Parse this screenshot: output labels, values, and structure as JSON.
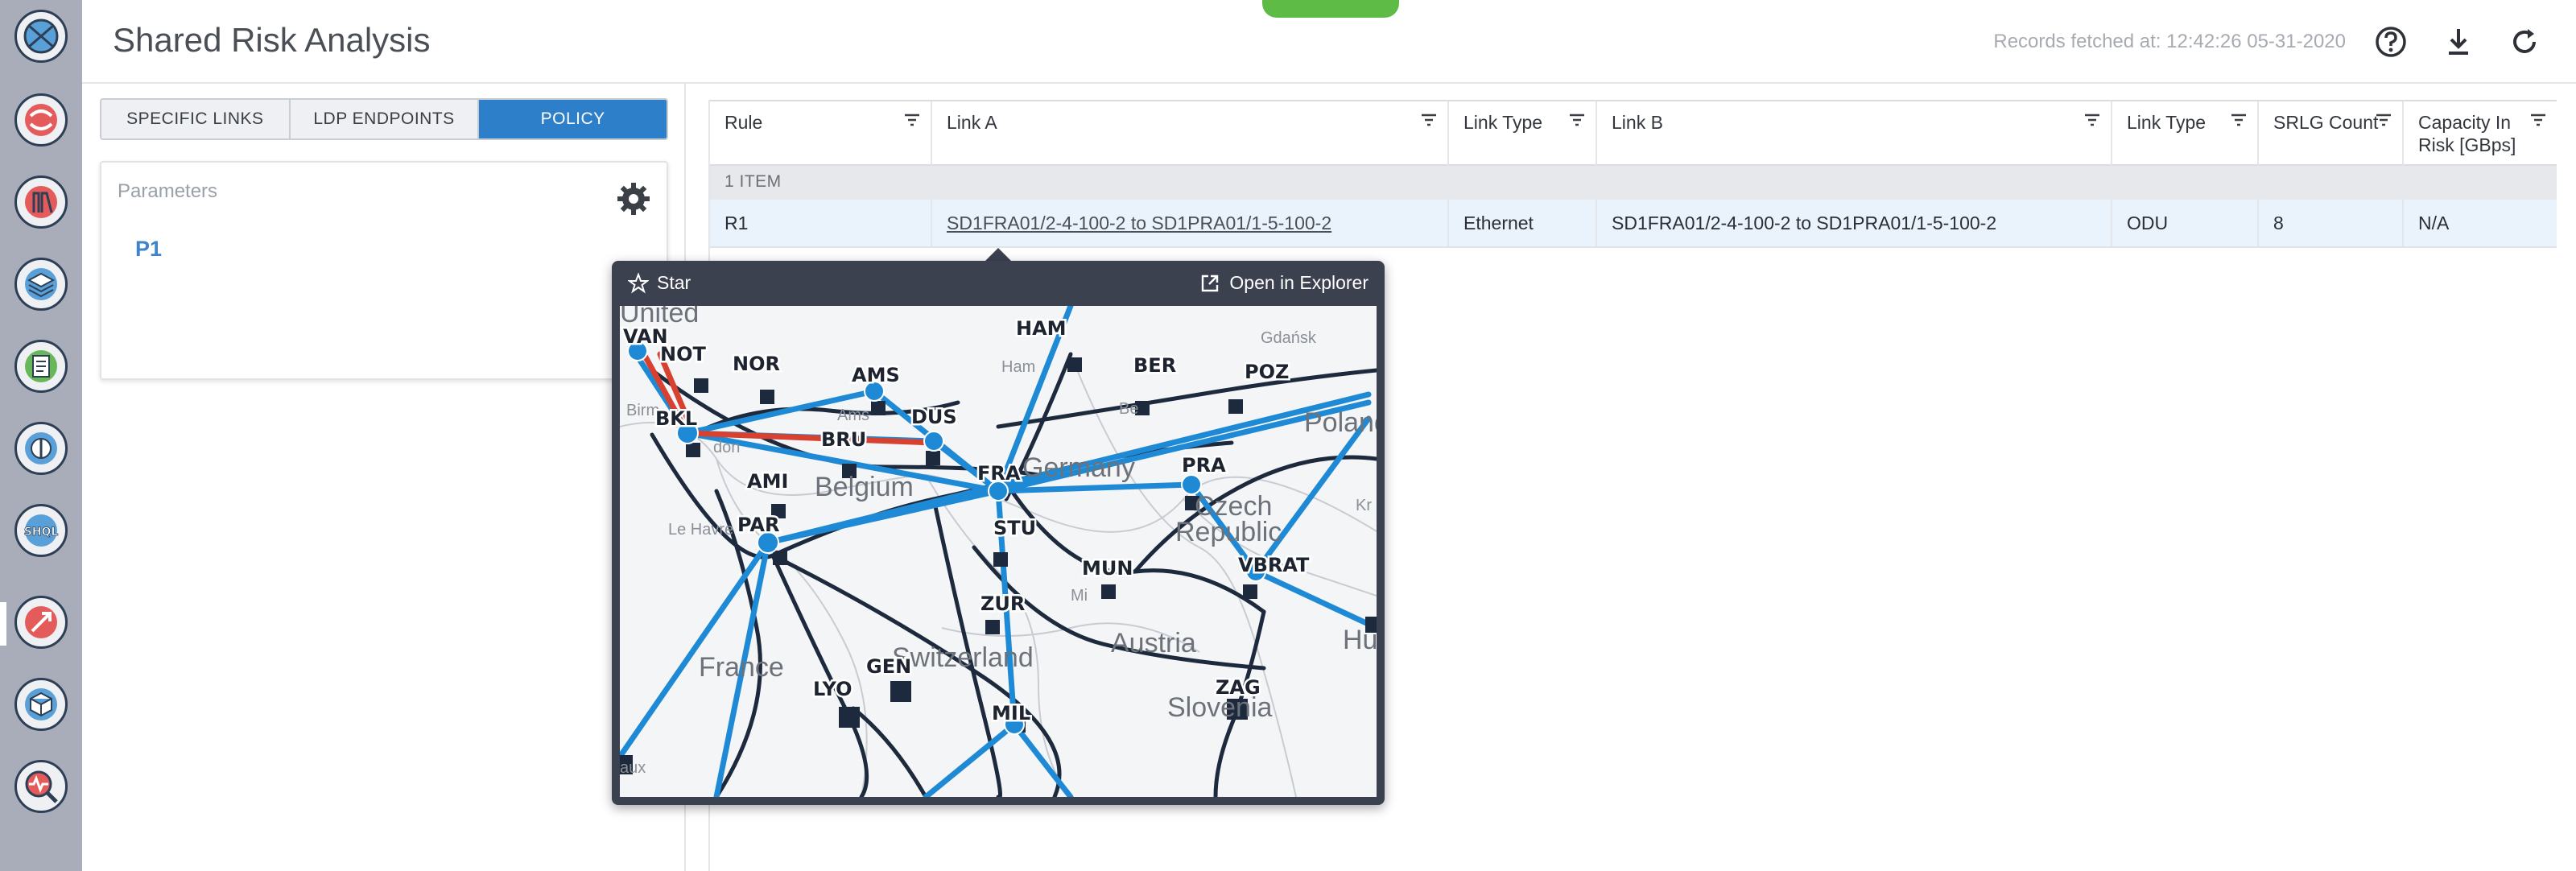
{
  "app": {
    "title": "Shared Risk Analysis",
    "records_fetched": "Records fetched at: 12:42:26 05-31-2020"
  },
  "header_icons": [
    "help-icon",
    "download-icon",
    "refresh-icon"
  ],
  "rail": {
    "icons": [
      "globe-icon",
      "swirl-icon",
      "ruler-icon",
      "layers-icon",
      "document-icon",
      "compass-icon",
      "shql-icon",
      "arrow-check-icon",
      "cube-icon",
      "search-pulse-icon"
    ],
    "shql_text": "SHQL"
  },
  "tabs": [
    {
      "label": "SPECIFIC LINKS",
      "active": false
    },
    {
      "label": "LDP ENDPOINTS",
      "active": false
    },
    {
      "label": "POLICY",
      "active": true
    }
  ],
  "parameters": {
    "label": "Parameters",
    "item": "P1"
  },
  "table": {
    "columns": [
      "Rule",
      "Link A",
      "Link Type",
      "Link B",
      "Link Type",
      "SRLG Count",
      "Capacity In Risk [GBps]"
    ],
    "group_label": "1 ITEM",
    "rows": [
      [
        "R1",
        "SD1FRA01/2-4-100-2 to SD1PRA01/1-5-100-2",
        "Ethernet",
        "SD1FRA01/2-4-100-2 to SD1PRA01/1-5-100-2",
        "ODU",
        "8",
        "N/A"
      ]
    ]
  },
  "popup": {
    "star_label": "Star",
    "open_label": "Open in Explorer",
    "map": {
      "nodes": [
        "VAN",
        "NOT",
        "NOR",
        "AMS",
        "HAM",
        "BER",
        "POZ",
        "BKL",
        "BRU",
        "DUS",
        "AMI",
        "FRA",
        "PRA",
        "STU",
        "PAR",
        "MUN",
        "VBRAT",
        "ZUR",
        "GEN",
        "LYO",
        "MIL",
        "ZAG"
      ],
      "places": [
        "United",
        "Belgium",
        "France",
        "Austria",
        "Slovenia",
        "Czech",
        "Republic",
        "Poland",
        "Le Havre",
        "Gdańsk",
        "Germany",
        "Switzerland",
        "Hu",
        "aux",
        "Birm",
        "Ams",
        "Ham",
        "Be",
        "don",
        "Mi",
        "Kr"
      ]
    }
  }
}
